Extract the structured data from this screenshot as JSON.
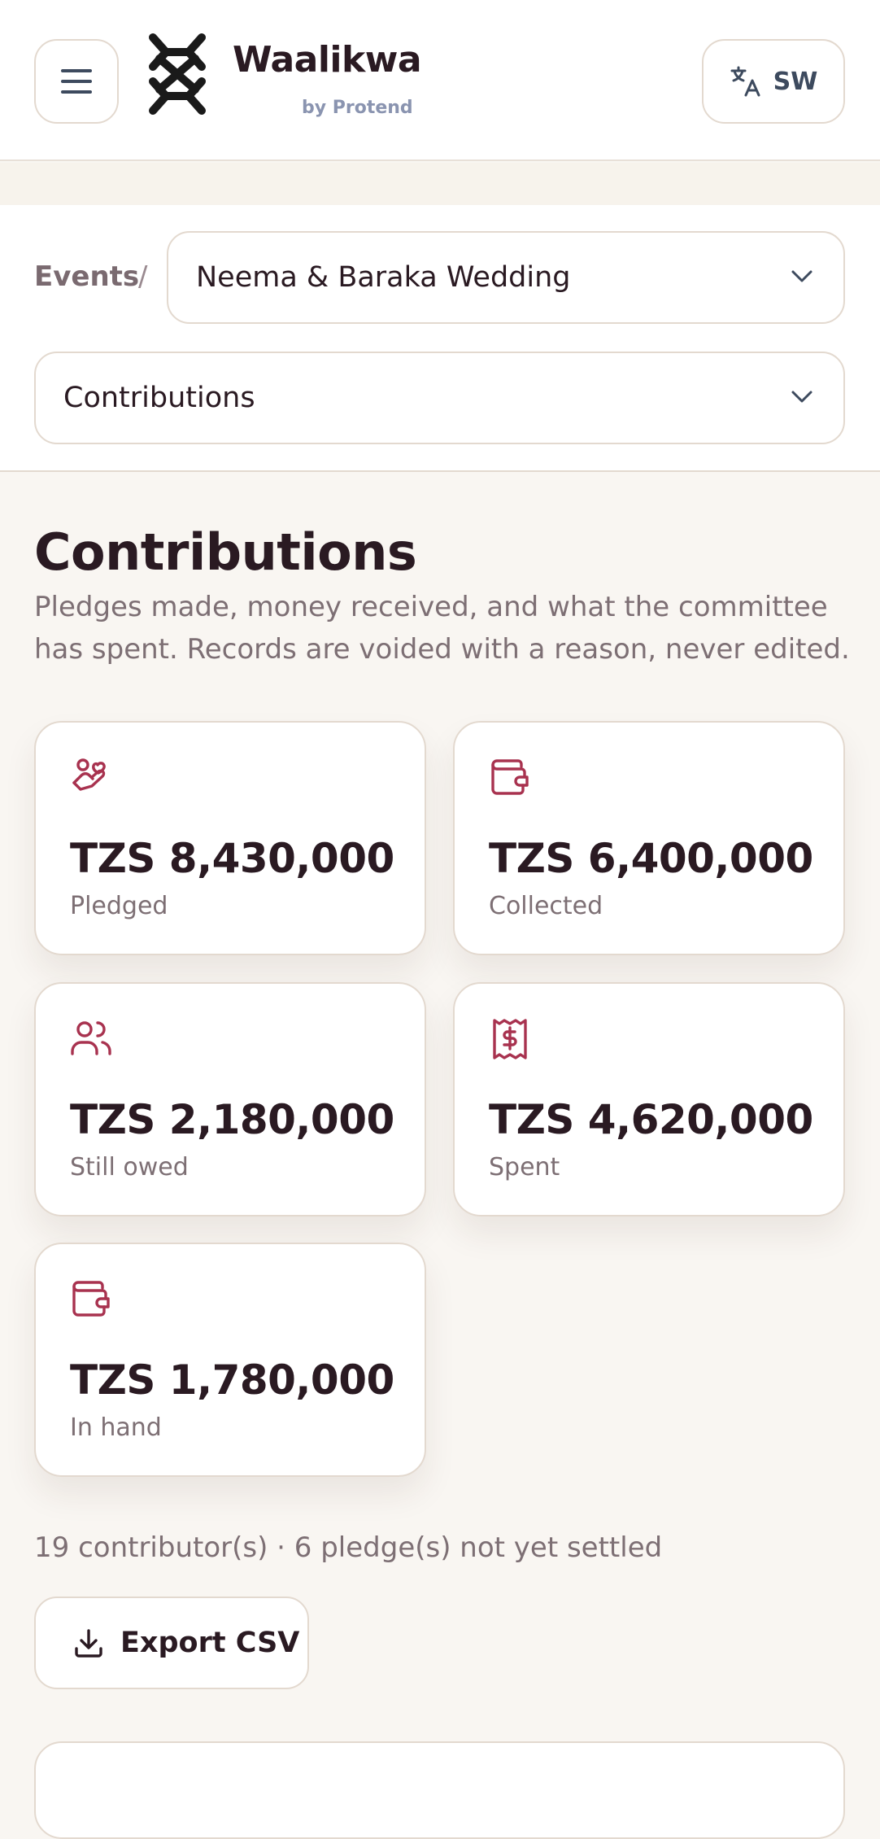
{
  "header": {
    "brand_name": "Waalikwa",
    "brand_sub": "by Protend",
    "language_code": "SW"
  },
  "breadcrumb": {
    "events_label": "Events",
    "separator": "/",
    "event_selected": "Neema & Baraka Wedding"
  },
  "section_select": {
    "selected": "Contributions"
  },
  "page": {
    "title": "Contributions",
    "description": "Pledges made, money received, and what the committee has spent. Records are voided with a reason, never edited."
  },
  "stats": [
    {
      "icon": "hand-heart-icon",
      "value": "TZS 8,430,000",
      "label": "Pledged"
    },
    {
      "icon": "wallet-icon",
      "value": "TZS 6,400,000",
      "label": "Collected"
    },
    {
      "icon": "users-icon",
      "value": "TZS 2,180,000",
      "label": "Still owed"
    },
    {
      "icon": "receipt-dollar-icon",
      "value": "TZS 4,620,000",
      "label": "Spent"
    },
    {
      "icon": "wallet-icon",
      "value": "TZS 1,780,000",
      "label": "In hand"
    }
  ],
  "summary": "19 contributor(s) · 6 pledge(s) not yet settled",
  "actions": {
    "export_label": "Export CSV"
  },
  "colors": {
    "accent": "#a8324f",
    "text": "#2a1a22",
    "muted": "#7d6f74",
    "border": "#e3d9cf",
    "background": "#f9f6f2"
  }
}
